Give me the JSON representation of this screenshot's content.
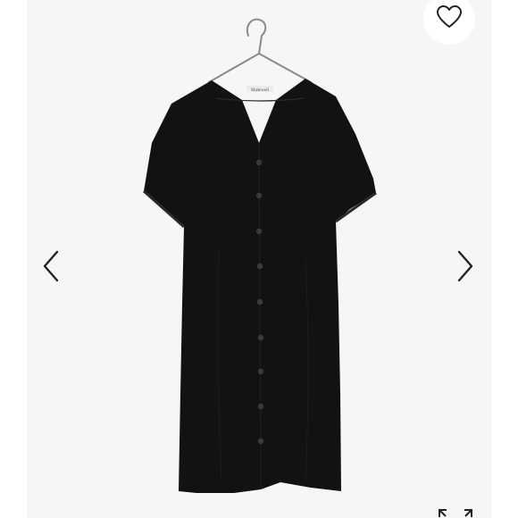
{
  "viewer": {
    "background_color": "#ffffff",
    "photo_background_color": "#f6f6f6",
    "product_color": "#121212",
    "button_color": "#3a3a3a"
  },
  "photo": {
    "garment_label_text": "Madewell"
  },
  "icons": {
    "previous": "chevron-left-icon",
    "next": "chevron-right-icon",
    "like": "heart-icon",
    "expand": "expand-icon"
  }
}
